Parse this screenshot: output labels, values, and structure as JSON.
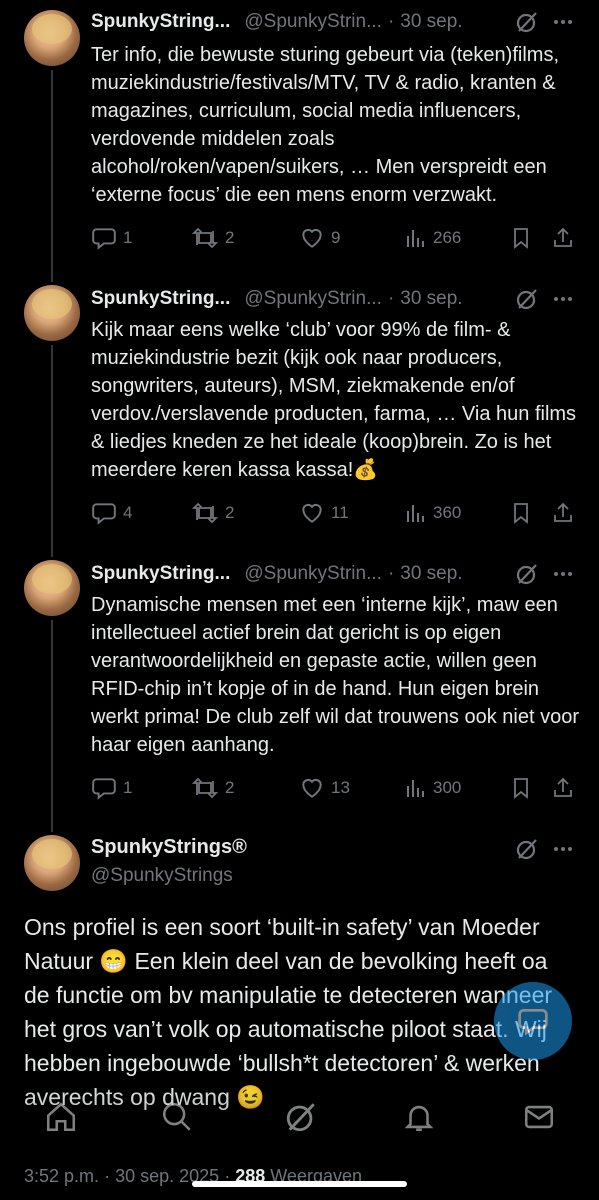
{
  "colors": {
    "background": "#000000",
    "text": "#e7e9ea",
    "muted": "#71767b",
    "accent": "#1d9bf0"
  },
  "tweets": [
    {
      "name": "SpunkyString...",
      "handle": "@SpunkyStrin...",
      "separator": "·",
      "date": "30 sep.",
      "text": "Ter info, die bewuste sturing gebeurt via (teken)films, muziekindustrie/festivals/MTV, TV & radio, kranten & magazines, curriculum, social media influencers, verdovende middelen zoals alcohol/roken/vapen/suikers, … Men verspreidt een ‘externe focus’ die een mens enorm verzwakt.",
      "replies": "1",
      "reposts": "2",
      "likes": "9",
      "views": "266"
    },
    {
      "name": "SpunkyString...",
      "handle": "@SpunkyStrin...",
      "separator": "·",
      "date": "30 sep.",
      "text": "Kijk maar eens welke ‘club’ voor 99% de film- & muziekindustrie bezit (kijk ook naar producers, songwriters, auteurs), MSM, ziekmakende en/of verdov./verslavende producten, farma, … Via hun films & liedjes kneden ze het ideale (koop)brein. Zo is het meerdere keren kassa kassa!💰",
      "replies": "4",
      "reposts": "2",
      "likes": "11",
      "views": "360"
    },
    {
      "name": "SpunkyString...",
      "handle": "@SpunkyStrin...",
      "separator": "·",
      "date": "30 sep.",
      "text": "Dynamische mensen met een ‘interne kijk’, maw een intellectueel actief brein dat gericht is op eigen verantwoordelijkheid en gepaste actie, willen geen RFID-chip in’t kopje of in de hand. Hun eigen brein werkt prima! De club zelf wil dat trouwens ook niet voor haar eigen aanhang.",
      "replies": "1",
      "reposts": "2",
      "likes": "13",
      "views": "300"
    }
  ],
  "main_tweet": {
    "name": "SpunkyStrings®",
    "handle": "@SpunkyStrings",
    "text": "Ons profiel is een soort ‘built-in safety’ van Moeder Natuur 😁 Een klein deel van de bevolking heeft oa de functie om bv manipulatie te detecteren wanneer het gros van’t volk op automatische piloot staat. Wij hebben ingebouwde ‘bullsh*t detectoren’ & werken averechts op dwang 😉",
    "time": "3:52 p.m.",
    "separator": "·",
    "date": "30 sep. 2025",
    "views_count": "288",
    "views_label": "Weergaven"
  },
  "icons": [
    "grok-icon",
    "more-icon",
    "reply-icon",
    "repost-icon",
    "like-icon",
    "views-icon",
    "bookmark-icon",
    "share-icon",
    "compose-icon",
    "home-icon",
    "search-icon",
    "grok-nav-icon",
    "notifications-icon",
    "messages-icon"
  ]
}
